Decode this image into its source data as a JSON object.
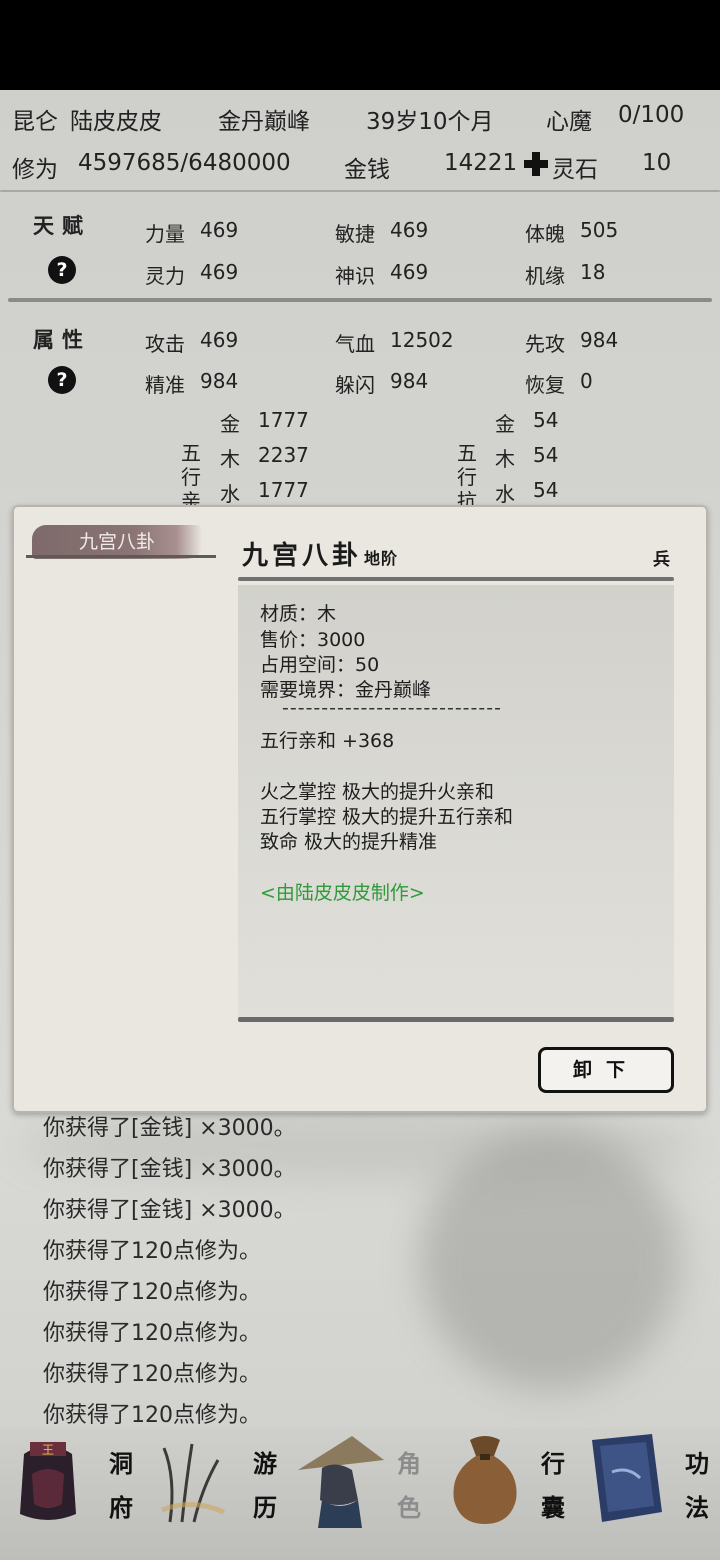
{
  "header": {
    "sect": "昆仑",
    "name": "陆皮皮皮",
    "realm": "金丹巅峰",
    "age": "39岁10个月",
    "demon_label": "心魔",
    "demon_value": "0/100",
    "cultivation_label": "修为",
    "cultivation_value": "4597685/6480000",
    "money_label": "金钱",
    "money_value": "14221",
    "spirit_stone_label": "灵石",
    "spirit_stone_value": "10"
  },
  "talent": {
    "title": "天赋",
    "help": "?",
    "stats": [
      {
        "label": "力量",
        "value": "469"
      },
      {
        "label": "敏捷",
        "value": "469"
      },
      {
        "label": "体魄",
        "value": "505"
      },
      {
        "label": "灵力",
        "value": "469"
      },
      {
        "label": "神识",
        "value": "469"
      },
      {
        "label": "机缘",
        "value": "18"
      }
    ]
  },
  "attributes": {
    "title": "属性",
    "help": "?",
    "stats": [
      {
        "label": "攻击",
        "value": "469"
      },
      {
        "label": "气血",
        "value": "12502"
      },
      {
        "label": "先攻",
        "value": "984"
      },
      {
        "label": "精准",
        "value": "984"
      },
      {
        "label": "躲闪",
        "value": "984"
      },
      {
        "label": "恢复",
        "value": "0"
      }
    ]
  },
  "elements": {
    "affinity_label_chars": [
      "五",
      "行",
      "亲"
    ],
    "resist_label_chars": [
      "五",
      "行",
      "抗"
    ],
    "affinity": [
      {
        "label": "金",
        "value": "1777"
      },
      {
        "label": "木",
        "value": "2237"
      },
      {
        "label": "水",
        "value": "1777"
      }
    ],
    "resist": [
      {
        "label": "金",
        "value": "54"
      },
      {
        "label": "木",
        "value": "54"
      },
      {
        "label": "水",
        "value": "54"
      }
    ]
  },
  "modal": {
    "tab_label": "九宫八卦",
    "item_name": "九宫八卦",
    "item_grade": "地阶",
    "item_type": "兵",
    "material": "材质：木",
    "price": "售价：3000",
    "space": "占用空间：50",
    "realm_req": "需要境界：金丹巅峰",
    "separator": "----------------------------",
    "bonus": "五行亲和 +368",
    "effects": [
      "火之掌控 极大的提升火亲和",
      "五行掌控 极大的提升五行亲和",
      "致命 极大的提升精准"
    ],
    "maker": "<由陆皮皮皮制作>",
    "unequip_label": "卸下"
  },
  "log": [
    "你获得了[金钱] ×3000。",
    "你获得了[金钱] ×3000。",
    "你获得了[金钱] ×3000。",
    "你获得了120点修为。",
    "你获得了120点修为。",
    "你获得了120点修为。",
    "你获得了120点修为。",
    "你获得了120点修为。"
  ],
  "nav": [
    {
      "chars": [
        "洞",
        "府"
      ],
      "icon": "cave-dwelling-icon"
    },
    {
      "chars": [
        "游",
        "历"
      ],
      "icon": "travel-icon"
    },
    {
      "chars": [
        "角",
        "色"
      ],
      "icon": "character-icon"
    },
    {
      "chars": [
        "行",
        "囊"
      ],
      "icon": "bag-icon"
    },
    {
      "chars": [
        "功",
        "法"
      ],
      "icon": "scroll-book-icon"
    }
  ],
  "colors": {
    "maker_text": "#2e9a3a",
    "tab_bg": "#8a7474",
    "panel_bg": "#e9e7df"
  }
}
